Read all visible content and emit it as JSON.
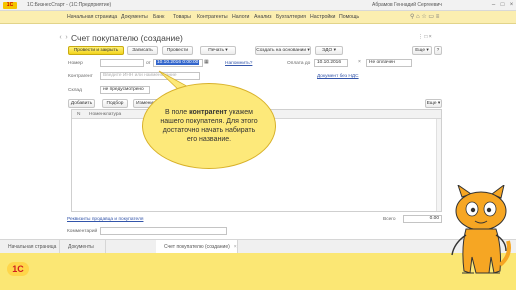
{
  "titlebar": {
    "logo": "1С",
    "title": "1С:БизнесСтарт - (1С:Предприятие)",
    "user": "Абрамов Геннадий Сергеевич",
    "controls": [
      "–",
      "□",
      "×"
    ]
  },
  "menu": {
    "items": [
      "Начальная страница",
      "Документы",
      "Банк",
      "Товары",
      "Контрагенты",
      "Налоги",
      "Анализ",
      "Бухгалтерия",
      "Настройки",
      "Помощь"
    ],
    "right_icons": "⚲ ⌂ ☆ ▭ ≡"
  },
  "form": {
    "title": "Счет покупателю (создание)",
    "nav_back": "‹",
    "nav_fwd": "›",
    "star": "☆",
    "header_icons": "⋮ □ ×",
    "toolbar": {
      "post_close": "Провести и закрыть",
      "write": "Записать",
      "post": "Провести",
      "print": "Печать ▾",
      "create_based": "Создать на основании ▾",
      "edo": "ЭДО ▾",
      "more": "Еще ▾",
      "help": "?"
    },
    "number": {
      "label": "Номер",
      "value": "",
      "from_label": "от",
      "date": "10.10.2016 0:00:00",
      "calendar_icon": "▦",
      "remind_link": "Напомнить?"
    },
    "payment": {
      "label": "Оплата до",
      "date": "10.10.2016",
      "status": "Не оплачен",
      "status_icon": "×"
    },
    "contractor": {
      "label": "Контрагент",
      "placeholder": "Введите ИНН или наименование",
      "vat_link": "Документ без НДС"
    },
    "warehouse": {
      "label": "Склад",
      "value": "не предусмотрено"
    },
    "table_toolbar": {
      "add": "Добавить",
      "select": "Подбор",
      "change": "Изменить",
      "up": "▲",
      "down": "▼",
      "more": "Еще ▾"
    },
    "columns": [
      "N",
      "Номенклатура"
    ],
    "bank_link": "Реквизиты продавца и покупателя",
    "totals": {
      "label": "Всего",
      "value": "0.00"
    },
    "comment": {
      "label": "Комментарий",
      "value": ""
    }
  },
  "callout": {
    "prefix": "В поле ",
    "bold": "контрагент",
    "suffix": " укажем нашего покупателя. Для этого достаточно начать набирать его название."
  },
  "tabs": [
    "Начальная страница",
    "Документы",
    "Счет покупателю (создание)"
  ],
  "bottom": {
    "logo": "1С"
  },
  "colors": {
    "menu_bg": "#fbeeb0",
    "primary_btn": "#f2d41c",
    "callout_bg": "#fde97a",
    "bottom_bg": "#fbe774",
    "cat": "#f6a623"
  }
}
